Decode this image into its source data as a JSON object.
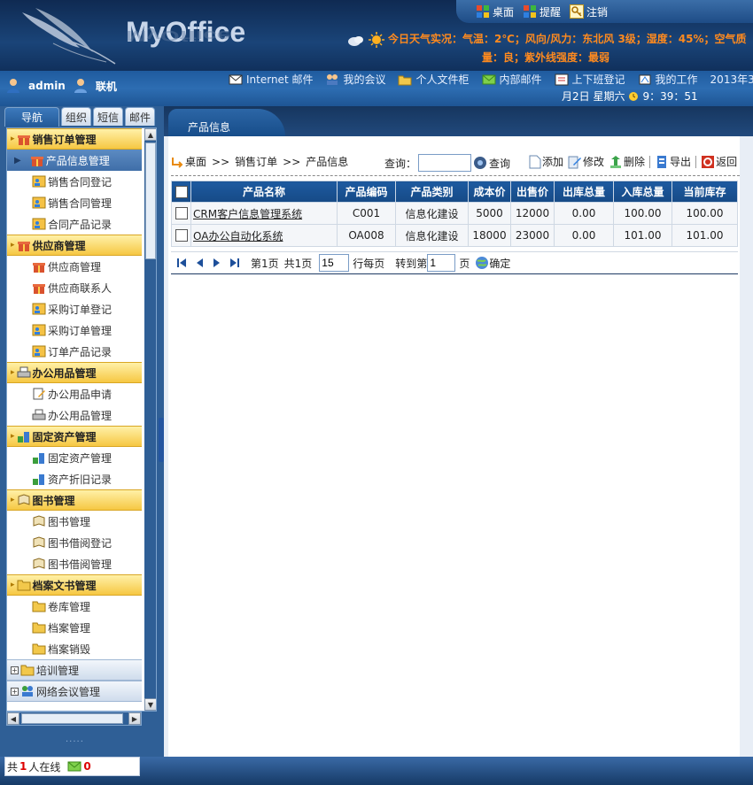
{
  "app": {
    "logo": "MyOffice"
  },
  "toplinks": [
    {
      "label": "桌面",
      "icon": "windows-icon"
    },
    {
      "label": "提醒",
      "icon": "windows-icon"
    },
    {
      "label": "注销",
      "icon": "key-icon"
    }
  ],
  "weather": {
    "line1": "今日天气实况：气温：2℃；风向/风力：东北风 3级；湿度：45%；空气质",
    "line2": "量：良；紫外线强度：最弱"
  },
  "user": {
    "name": "admin",
    "status": "联机"
  },
  "quicklinks": [
    {
      "label": "Internet 邮件"
    },
    {
      "label": "我的会议"
    },
    {
      "label": "个人文件柜"
    },
    {
      "label": "内部邮件"
    },
    {
      "label": "上下班登记"
    },
    {
      "label": "我的工作"
    }
  ],
  "datetime": {
    "year": "2013年3",
    "day": "月2日 星期六",
    "time": "9：39：51"
  },
  "navtabs": [
    "导航",
    "组织",
    "短信",
    "邮件"
  ],
  "menu": {
    "g1": "销售订单管理",
    "g1_items": [
      "产品信息管理",
      "销售合同登记",
      "销售合同管理",
      "合同产品记录"
    ],
    "g2": "供应商管理",
    "g2_items": [
      "供应商管理",
      "供应商联系人",
      "采购订单登记",
      "采购订单管理",
      "订单产品记录"
    ],
    "g3": "办公用品管理",
    "g3_items": [
      "办公用品申请",
      "办公用品管理"
    ],
    "g4": "固定资产管理",
    "g4_items": [
      "固定资产管理",
      "资产折旧记录"
    ],
    "g5": "图书管理",
    "g5_items": [
      "图书管理",
      "图书借阅登记",
      "图书借阅管理"
    ],
    "g6": "档案文书管理",
    "g6_items": [
      "卷库管理",
      "档案管理",
      "档案销毁"
    ],
    "g7": "培训管理",
    "g8": "网络会议管理"
  },
  "content": {
    "tab": "产品信息",
    "crumb": [
      "桌面",
      "销售订单",
      "产品信息"
    ],
    "crumb_sep": ">>",
    "query_label": "查询：",
    "query_value": "",
    "query_button": "查询",
    "actions": [
      "添加",
      "修改",
      "删除",
      "导出",
      "返回"
    ]
  },
  "table": {
    "headers": [
      "产品名称",
      "产品编码",
      "产品类别",
      "成本价",
      "出售价",
      "出库总量",
      "入库总量",
      "当前库存"
    ],
    "rows": [
      [
        "CRM客户信息管理系统",
        "C001",
        "信息化建设",
        "5000",
        "12000",
        "0.00",
        "100.00",
        "100.00"
      ],
      [
        "OA办公自动化系统",
        "OA008",
        "信息化建设",
        "18000",
        "23000",
        "0.00",
        "101.00",
        "101.00"
      ]
    ]
  },
  "pager": {
    "page_text": "第1页",
    "total_text": "共1页",
    "per_page": "15",
    "per_page_label": "行每页",
    "goto_label": "转到第",
    "goto_value": "1",
    "page_unit": "页",
    "confirm": "确定"
  },
  "status": {
    "prefix": "共",
    "count": "1",
    "suffix": "人在线",
    "mail_count": "0"
  },
  "colors": {
    "accent_orange": "#ff8a1e",
    "nav_blue": "#1f5b9e",
    "header_table": "#1d5aa0",
    "group_yellow": "#f6c743"
  }
}
